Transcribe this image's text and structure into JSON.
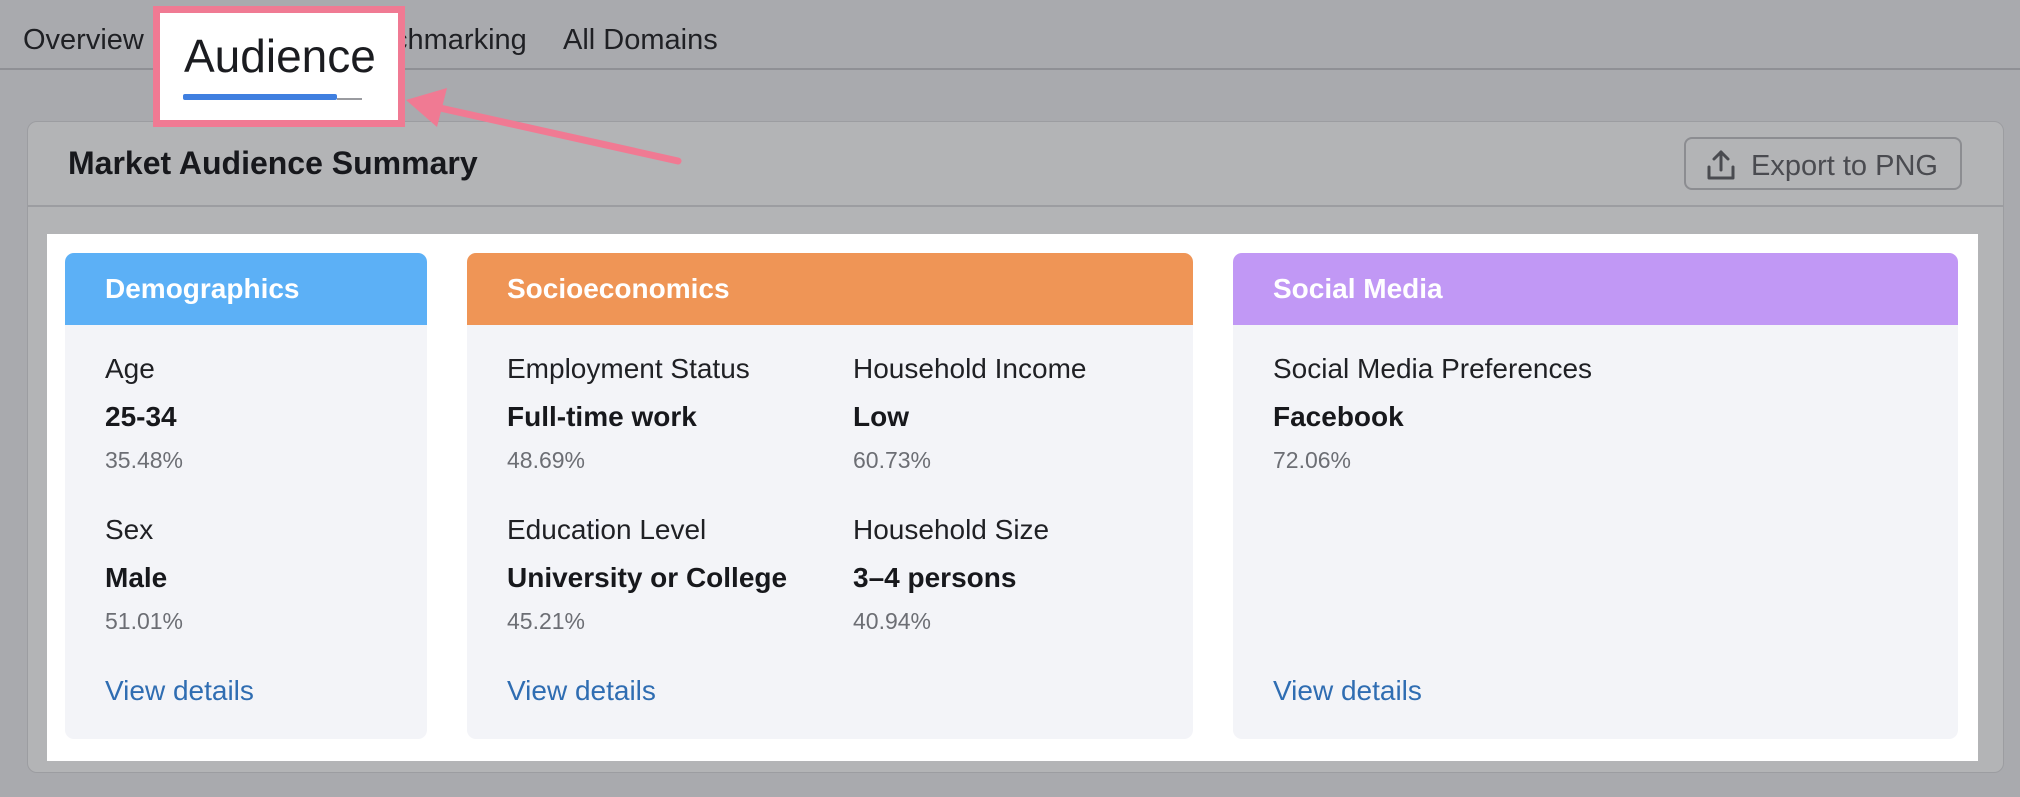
{
  "tabs": {
    "overview": "Overview",
    "audience": "Audience",
    "benchmarking_fragment": "chmarking",
    "all_domains": "All Domains"
  },
  "panel": {
    "title": "Market Audience Summary",
    "export_label": "Export to PNG"
  },
  "cards": {
    "demographics": {
      "title": "Demographics",
      "age": {
        "label": "Age",
        "value": "25-34",
        "percent": "35.48%"
      },
      "sex": {
        "label": "Sex",
        "value": "Male",
        "percent": "51.01%"
      },
      "link": "View details"
    },
    "socioeconomics": {
      "title": "Socioeconomics",
      "employment": {
        "label": "Employment Status",
        "value": "Full-time work",
        "percent": "48.69%"
      },
      "income": {
        "label": "Household Income",
        "value": "Low",
        "percent": "60.73%"
      },
      "education": {
        "label": "Education Level",
        "value": "University or College",
        "percent": "45.21%"
      },
      "household_size": {
        "label": "Household Size",
        "value": "3–4 persons",
        "percent": "40.94%"
      },
      "link": "View details"
    },
    "social_media": {
      "title": "Social Media",
      "preferences": {
        "label": "Social Media Preferences",
        "value": "Facebook",
        "percent": "72.06%"
      },
      "link": "View details"
    }
  },
  "colors": {
    "demographics_header": "#5cb0f6",
    "socioeconomics_header": "#ef9556",
    "social_media_header": "#c198f5",
    "highlight": "#f07a93",
    "active_tab_underline": "#3f7fe0",
    "link": "#2f6db2"
  },
  "icons": {
    "export": "upload-icon",
    "annotation": "arrow-icon"
  }
}
